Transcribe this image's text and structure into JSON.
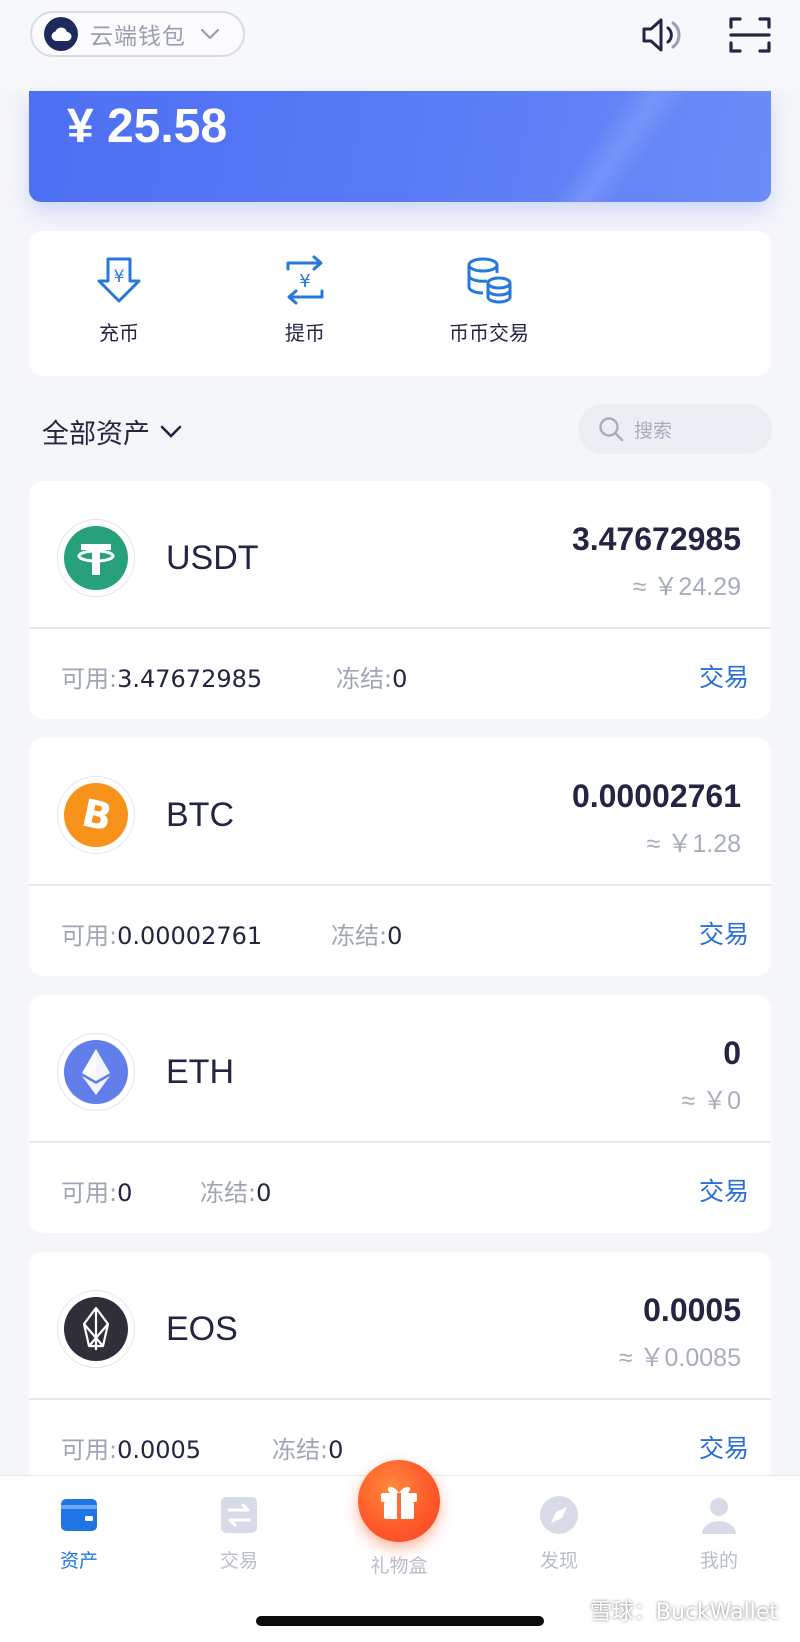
{
  "header": {
    "wallet_name": "云端钱包"
  },
  "balance": {
    "amount": "¥ 25.58"
  },
  "actions": [
    {
      "label": "充币",
      "icon": "deposit-icon"
    },
    {
      "label": "提币",
      "icon": "withdraw-icon"
    },
    {
      "label": "币币交易",
      "icon": "coin-exchange-icon"
    }
  ],
  "filter": {
    "title": "全部资产",
    "search_placeholder": "搜索"
  },
  "assets": [
    {
      "symbol": "USDT",
      "amount": "3.47672985",
      "value": "≈ ￥24.29",
      "available_label": "可用:",
      "available": "3.47672985",
      "frozen_label": "冻结:",
      "frozen": "0",
      "trade": "交易",
      "logo_color": "#26a17b"
    },
    {
      "symbol": "BTC",
      "amount": "0.00002761",
      "value": "≈ ￥1.28",
      "available_label": "可用:",
      "available": "0.00002761",
      "frozen_label": "冻结:",
      "frozen": "0",
      "trade": "交易",
      "logo_color": "#f7931a"
    },
    {
      "symbol": "ETH",
      "amount": "0",
      "value": "≈ ￥0",
      "available_label": "可用:",
      "available": "0",
      "frozen_label": "冻结:",
      "frozen": "0",
      "trade": "交易",
      "logo_color": "#627eea"
    },
    {
      "symbol": "EOS",
      "amount": "0.0005",
      "value": "≈ ￥0.0085",
      "available_label": "可用:",
      "available": "0.0005",
      "frozen_label": "冻结:",
      "frozen": "0",
      "trade": "交易",
      "logo_color": "#2f2f3a"
    }
  ],
  "nav": {
    "items": [
      {
        "label": "资产",
        "active": true
      },
      {
        "label": "交易"
      },
      {
        "label": "礼物盒"
      },
      {
        "label": "发现"
      },
      {
        "label": "我的"
      }
    ]
  },
  "watermark": {
    "text": "雪球：BuckWallet"
  },
  "colors": {
    "accent": "#1f74e6",
    "balance_card": "#5577f4",
    "gift": "#ff5a2a"
  }
}
